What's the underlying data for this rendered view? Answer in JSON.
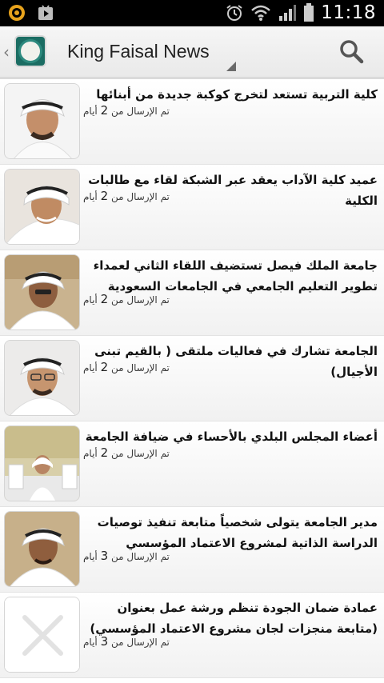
{
  "status_bar": {
    "time": "11:18",
    "icons": [
      "notification-icon",
      "play-store-icon",
      "alarm-icon",
      "wifi-icon",
      "signal-icon",
      "battery-icon"
    ]
  },
  "app_bar": {
    "title": "King Faisal News",
    "logo": "king-faisal-university-logo",
    "search_icon": "search-icon"
  },
  "news_items": [
    {
      "headline": "كلية التربية تستعد لتخرج كوكبة جديدة من أبنائها",
      "meta_prefix": "تم الإرسال من",
      "days": "2",
      "meta_suffix": "أيام",
      "thumb": "photo-man-white-ghutra"
    },
    {
      "headline": "عميد كلية الآداب يعقد عبر الشبكة لقاء مع طالبات الكلية",
      "meta_prefix": "تم الإرسال من",
      "days": "2",
      "meta_suffix": "أيام",
      "thumb": "photo-man-smiling"
    },
    {
      "headline": "جامعة الملك فيصل تستضيف اللقاء الثاني لعمداء تطوير التعليم الجامعي في الجامعات السعودية",
      "meta_prefix": "تم الإرسال من",
      "days": "2",
      "meta_suffix": "أيام",
      "thumb": "photo-man-at-desk"
    },
    {
      "headline": "الجامعة تشارك في فعاليات ملتقى ( بالقيم تبنى الأجيال)",
      "meta_prefix": "تم الإرسال من",
      "days": "2",
      "meta_suffix": "أيام",
      "thumb": "photo-man-with-glasses"
    },
    {
      "headline": "أعضاء المجلس البلدي بالأحساء في ضيافة الجامعة",
      "meta_prefix": "تم الإرسال من",
      "days": "2",
      "meta_suffix": "أيام",
      "thumb": "photo-meeting-room"
    },
    {
      "headline": "مدير الجامعة يتولى شخصياً متابعة تنفيذ توصيات الدراسة الذاتية لمشروع الاعتماد المؤسسي",
      "meta_prefix": "تم الإرسال من",
      "days": "3",
      "meta_suffix": "أيام",
      "thumb": "photo-man-portrait"
    },
    {
      "headline": "عمادة ضمان الجودة تنظم ورشة عمل بعنوان (متابعة منجزات لجان مشروع الاعتماد المؤسسي)",
      "meta_prefix": "تم الإرسال من",
      "days": "3",
      "meta_suffix": "أيام",
      "thumb": "placeholder-empty-image"
    }
  ]
}
